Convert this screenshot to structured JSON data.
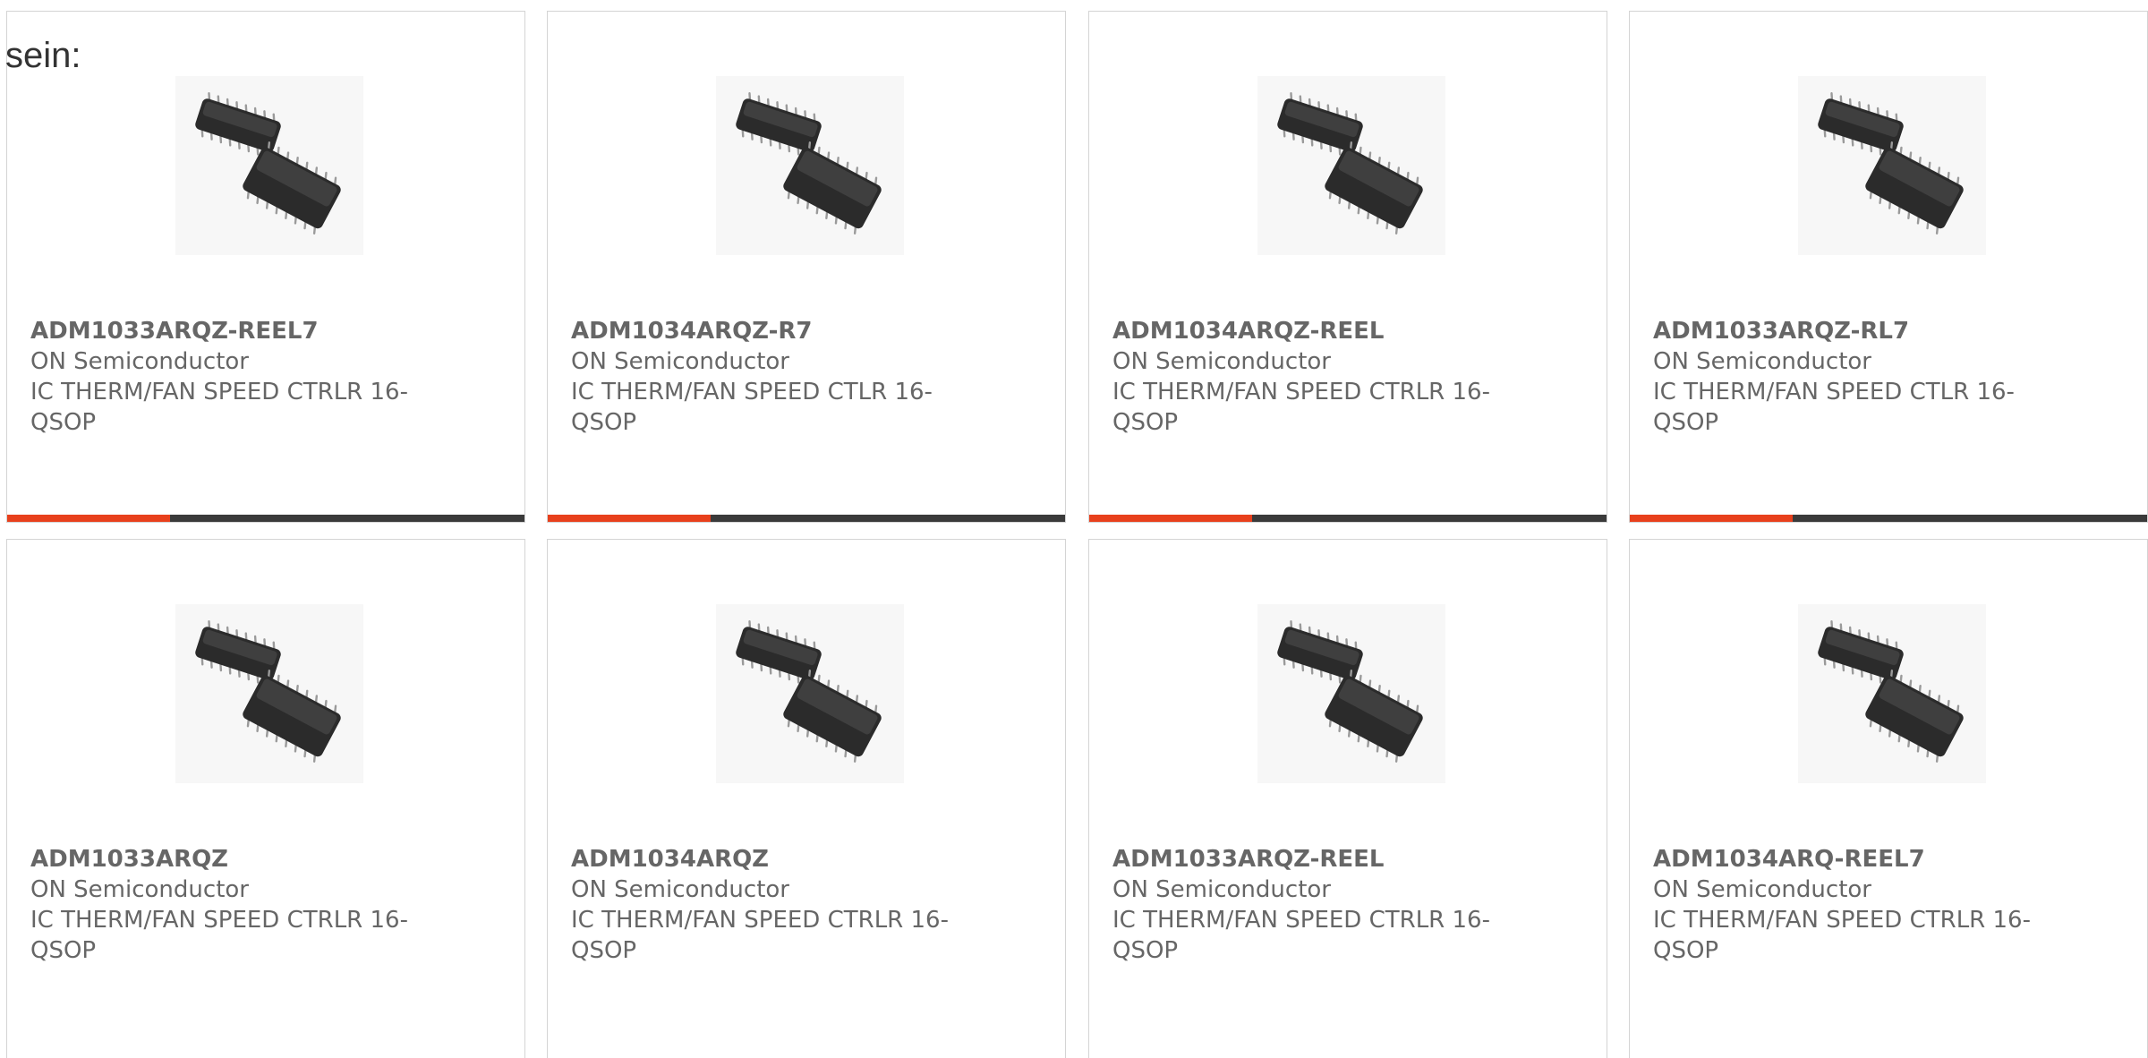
{
  "intro_text": "sein:",
  "accent_color": "#e8401c",
  "bar_color": "#3a3a3a",
  "products": [
    {
      "part": "ADM1033ARQZ-REEL7",
      "manufacturer": "ON Semiconductor",
      "description": "IC THERM/FAN SPEED CTRLR 16-QSOP",
      "image_icon": "qsop-16-chip-image"
    },
    {
      "part": "ADM1034ARQZ-R7",
      "manufacturer": "ON Semiconductor",
      "description": "IC THERM/FAN SPEED CTLR 16-QSOP",
      "image_icon": "qsop-16-chip-image"
    },
    {
      "part": "ADM1034ARQZ-REEL",
      "manufacturer": "ON Semiconductor",
      "description": "IC THERM/FAN SPEED CTRLR 16-QSOP",
      "image_icon": "qsop-16-chip-image"
    },
    {
      "part": "ADM1033ARQZ-RL7",
      "manufacturer": "ON Semiconductor",
      "description": "IC THERM/FAN SPEED CTLR 16-QSOP",
      "image_icon": "qsop-16-chip-image"
    },
    {
      "part": "ADM1033ARQZ",
      "manufacturer": "ON Semiconductor",
      "description": "IC THERM/FAN SPEED CTRLR 16-QSOP",
      "image_icon": "qsop-16-chip-image"
    },
    {
      "part": "ADM1034ARQZ",
      "manufacturer": "ON Semiconductor",
      "description": "IC THERM/FAN SPEED CTRLR 16-QSOP",
      "image_icon": "qsop-16-chip-image"
    },
    {
      "part": "ADM1033ARQZ-REEL",
      "manufacturer": "ON Semiconductor",
      "description": "IC THERM/FAN SPEED CTRLR 16-QSOP",
      "image_icon": "qsop-16-chip-image"
    },
    {
      "part": "ADM1034ARQ-REEL7",
      "manufacturer": "ON Semiconductor",
      "description": "IC THERM/FAN SPEED CTRLR 16-QSOP",
      "image_icon": "qsop-16-chip-image"
    }
  ]
}
